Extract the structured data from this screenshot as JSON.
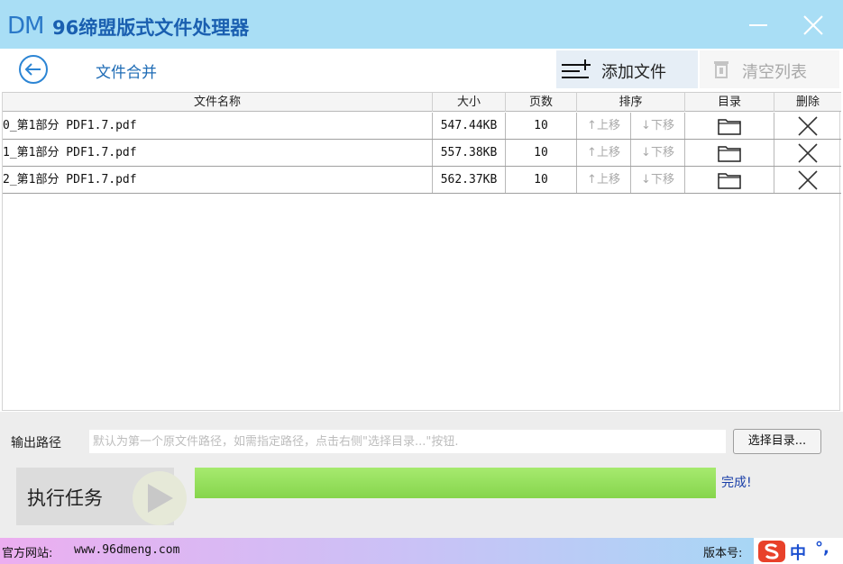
{
  "app": {
    "logo": "DM",
    "title": "96缔盟版式文件处理器"
  },
  "toolbar": {
    "page_title": "文件合并",
    "add_label": "添加文件",
    "clear_label": "清空列表"
  },
  "table": {
    "headers": [
      "文件名称",
      "大小",
      "页数",
      "排序",
      "目录",
      "删除"
    ],
    "move_up": "↑上移",
    "move_down": "↓下移",
    "rows": [
      {
        "name": "0_第1部分 PDF1.7.pdf",
        "size": "547.44KB",
        "pages": "10"
      },
      {
        "name": "1_第1部分 PDF1.7.pdf",
        "size": "557.38KB",
        "pages": "10"
      },
      {
        "name": "2_第1部分 PDF1.7.pdf",
        "size": "562.37KB",
        "pages": "10"
      }
    ]
  },
  "output": {
    "label": "输出路径",
    "placeholder": "默认为第一个原文件路径，如需指定路径，点击右侧\"选择目录...\"按钮.",
    "pick_label": "选择目录..."
  },
  "run": {
    "label": "执行任务",
    "progress": 1.0,
    "status": "完成!"
  },
  "statusbar": {
    "site_label": "官方网站:",
    "site_url": "www.96dmeng.com",
    "version_label": "版本号:"
  },
  "ime": {
    "lang": "中",
    "punct": "°,"
  },
  "colors": {
    "titlebar": "#a9def5",
    "accent": "#1d6bb5",
    "progress": "#94dd5b"
  }
}
